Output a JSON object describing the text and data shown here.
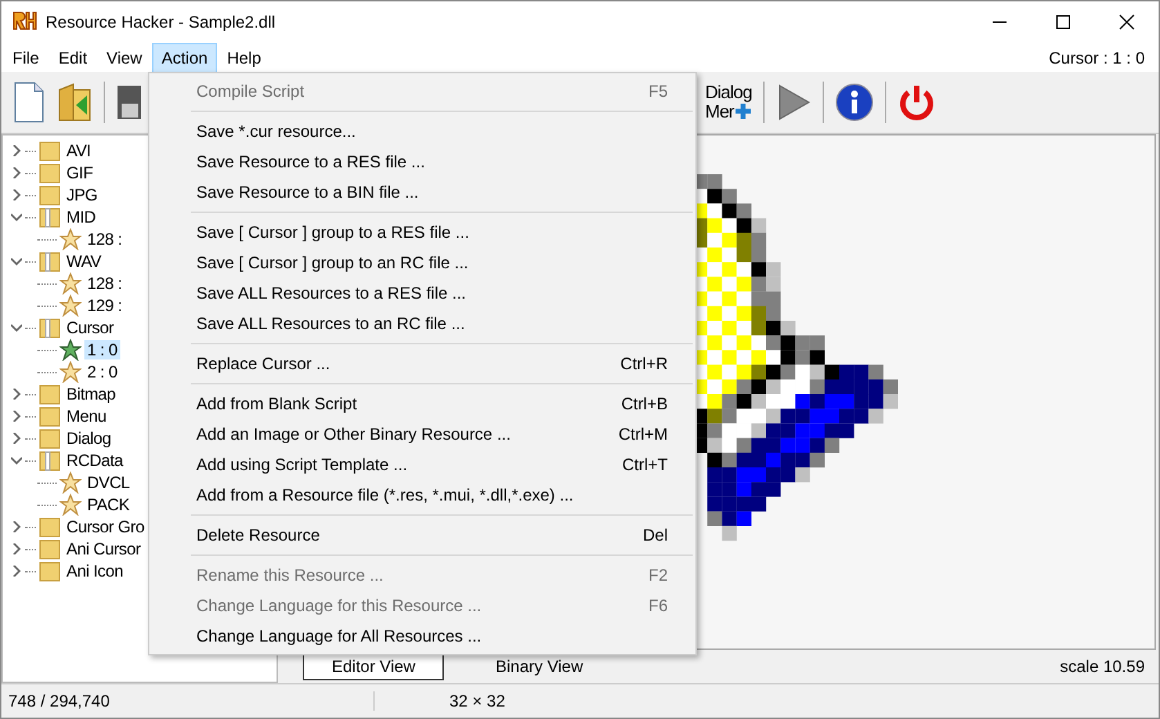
{
  "window": {
    "title": "Resource Hacker - Sample2.dll"
  },
  "menu_bar": {
    "items": [
      {
        "label": "File",
        "selected": false
      },
      {
        "label": "Edit",
        "selected": false
      },
      {
        "label": "View",
        "selected": false
      },
      {
        "label": "Action",
        "selected": true
      },
      {
        "label": "Help",
        "selected": false
      }
    ],
    "status": "Cursor : 1 : 0"
  },
  "toolbar": {
    "dialog_menu_button": {
      "line_1": "Dialog",
      "line_2": "Mer"
    }
  },
  "tree": [
    {
      "label": "AVI",
      "expanded": false
    },
    {
      "label": "GIF",
      "expanded": false
    },
    {
      "label": "JPG",
      "expanded": false
    },
    {
      "label": "MID",
      "expanded": true,
      "children": [
        {
          "label": "128 :",
          "selected": false
        }
      ]
    },
    {
      "label": "WAV",
      "expanded": true,
      "children": [
        {
          "label": "128 :",
          "selected": false
        },
        {
          "label": "129 :",
          "selected": false
        }
      ]
    },
    {
      "label": "Cursor",
      "expanded": true,
      "children": [
        {
          "label": "1 : 0",
          "selected": true
        },
        {
          "label": "2 : 0",
          "selected": false
        }
      ]
    },
    {
      "label": "Bitmap",
      "expanded": false
    },
    {
      "label": "Menu",
      "expanded": false
    },
    {
      "label": "Dialog",
      "expanded": false
    },
    {
      "label": "RCData",
      "expanded": true,
      "children": [
        {
          "label": "DVCL",
          "selected": false
        },
        {
          "label": "PACK",
          "selected": false
        }
      ]
    },
    {
      "label": "Cursor Gro",
      "expanded": false
    },
    {
      "label": "Ani Cursor",
      "expanded": false
    },
    {
      "label": "Ani Icon",
      "expanded": false
    }
  ],
  "action_menu": [
    {
      "kind": "item",
      "label": "Compile Script",
      "shortcut": "F5",
      "disabled": true
    },
    {
      "kind": "separator"
    },
    {
      "kind": "item",
      "label": "Save *.cur resource...",
      "disabled": false
    },
    {
      "kind": "item",
      "label": "Save Resource to a RES file ...",
      "disabled": false
    },
    {
      "kind": "item",
      "label": "Save Resource to a BIN file ...",
      "disabled": false
    },
    {
      "kind": "separator"
    },
    {
      "kind": "item",
      "label": "Save [ Cursor ] group to a RES file ...",
      "disabled": false
    },
    {
      "kind": "item",
      "label": "Save [ Cursor ] group to an RC file ...",
      "disabled": false
    },
    {
      "kind": "item",
      "label": "Save ALL Resources to a RES file ...",
      "disabled": false
    },
    {
      "kind": "item",
      "label": "Save ALL Resources to an RC file ...",
      "disabled": false
    },
    {
      "kind": "separator"
    },
    {
      "kind": "item",
      "label": "Replace Cursor ...",
      "shortcut": "Ctrl+R",
      "disabled": false
    },
    {
      "kind": "separator"
    },
    {
      "kind": "item",
      "label": "Add from Blank Script",
      "shortcut": "Ctrl+B",
      "disabled": false
    },
    {
      "kind": "item",
      "label": "Add an Image or Other Binary Resource ...",
      "shortcut": "Ctrl+M",
      "disabled": false
    },
    {
      "kind": "item",
      "label": "Add using Script Template ...",
      "shortcut": "Ctrl+T",
      "disabled": false
    },
    {
      "kind": "item",
      "label": "Add from a Resource file (*.res, *.mui, *.dll,*.exe) ...",
      "disabled": false
    },
    {
      "kind": "separator"
    },
    {
      "kind": "item",
      "label": "Delete Resource",
      "shortcut": "Del",
      "disabled": false
    },
    {
      "kind": "separator"
    },
    {
      "kind": "item",
      "label": "Rename this Resource ...",
      "shortcut": "F2",
      "disabled": true
    },
    {
      "kind": "item",
      "label": "Change Language for this Resource ...",
      "shortcut": "F6",
      "disabled": true
    },
    {
      "kind": "item",
      "label": "Change Language for All Resources ...",
      "disabled": false
    }
  ],
  "view_tabs": [
    {
      "label": "Editor View",
      "selected": true
    },
    {
      "label": "Binary View",
      "selected": false
    }
  ],
  "scale": "scale 10.59",
  "status_bar": {
    "position": "748 / 294,740",
    "size": "32 × 32"
  }
}
